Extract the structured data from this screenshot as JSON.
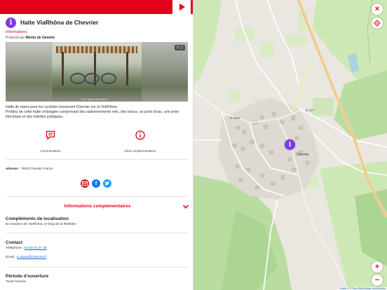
{
  "poi": {
    "title": "Halte ViaRhôna de Chevrier",
    "category": "Informations",
    "proposed_prefix": "Proposé par",
    "proposed_by": "Monts de Genève",
    "photo_counter": "2",
    "photo_credit": "© OT Monts de Genève",
    "description_line1": "Halte de repos pour les cyclistes traversant Chevrier sur la ViaRhôna.",
    "description_line2": "Profitez de cette halte ombragée comprenant des stationnements vélo, des bancs, un point d'eau, une prise électrique et des toilettes publiques."
  },
  "actions": {
    "comments_label": "Commentaires",
    "info_label": "Infos complémentaires"
  },
  "address": {
    "label": "Adresse",
    "value": ": 74520 Chevrier France"
  },
  "more_info": {
    "title": "Informations complémentaires"
  },
  "location_details": {
    "title": "Compléments de localisation",
    "text": "En bordure de ViaRhôna, le long de la RD908A"
  },
  "contact": {
    "title": "Contact",
    "phone_label": "Téléphone :",
    "phone": "04 50 04 37 45",
    "email_label": "Email :",
    "email": "s.cbavs@chevrier.fr"
  },
  "opening": {
    "title": "Période d'ouverture",
    "text": "Toute l'année."
  },
  "map": {
    "village_label": "Chevrier",
    "road_d908a": "D 908a",
    "road_d237": "D 237",
    "road_d908_2": "D 908a",
    "zoom_in": "+",
    "zoom_out": "−",
    "close": "×",
    "attribution_leaflet": "Leaflet",
    "attribution_sep": " | © ",
    "attribution_osm": "OpenStreetMap contributors"
  },
  "icons": {
    "play": "play-icon",
    "info": "info-icon",
    "comments": "comment-icon",
    "mail": "mail-icon",
    "facebook": "facebook-icon",
    "twitter": "twitter-icon",
    "chevron": "chevron-down-icon",
    "close": "close-icon",
    "locate": "locate-icon",
    "marker": "info-marker-icon"
  },
  "colors": {
    "accent": "#e2001a",
    "marker": "#7c3aed",
    "link": "#1565c0"
  }
}
